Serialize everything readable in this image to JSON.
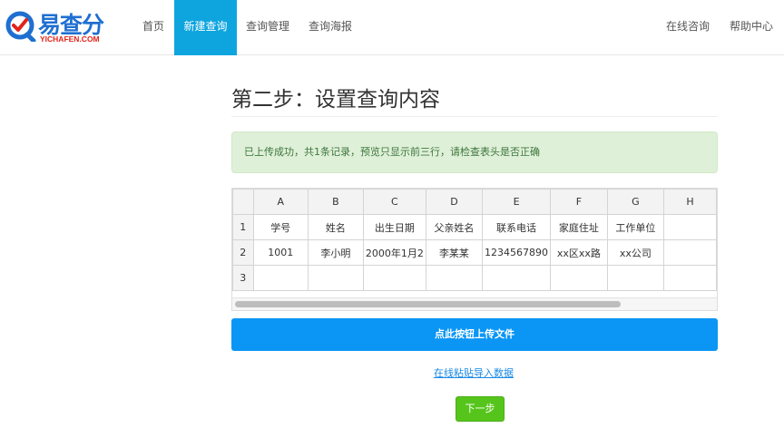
{
  "brand": {
    "name_cn": "易查分",
    "name_en": "YICHAFEN.COM",
    "colors": {
      "blue": "#1f6fd1",
      "red": "#e2231a"
    }
  },
  "nav": {
    "items": [
      {
        "label": "首页",
        "active": false
      },
      {
        "label": "新建查询",
        "active": true
      },
      {
        "label": "查询管理",
        "active": false
      },
      {
        "label": "查询海报",
        "active": false
      }
    ],
    "right_items": [
      {
        "label": "在线咨询"
      },
      {
        "label": "帮助中心"
      }
    ],
    "active_color": "#0ea5df"
  },
  "main": {
    "title": "第二步：设置查询内容",
    "alert": "已上传成功，共1条记录，预览只显示前三行，请检查表头是否正确",
    "sheet": {
      "columns": [
        "A",
        "B",
        "C",
        "D",
        "E",
        "F",
        "G",
        "H"
      ],
      "rows": [
        {
          "num": "1",
          "cells": [
            "学号",
            "姓名",
            "出生日期",
            "父亲姓名",
            "联系电话",
            "家庭住址",
            "工作单位",
            ""
          ]
        },
        {
          "num": "2",
          "cells": [
            "1001",
            "李小明",
            "2000年1月2",
            "李某某",
            "1234567890",
            "xx区xx路",
            "xx公司",
            ""
          ]
        },
        {
          "num": "3",
          "cells": [
            "",
            "",
            "",
            "",
            "",
            "",
            "",
            ""
          ]
        }
      ]
    },
    "upload_button": "点此按钮上传文件",
    "paste_link": "在线粘贴导入数据",
    "next_button": "下一步",
    "colors": {
      "upload": "#0b96f5",
      "next": "#56c51b",
      "alert_bg": "#dff0d8",
      "alert_text": "#3c763d"
    }
  }
}
